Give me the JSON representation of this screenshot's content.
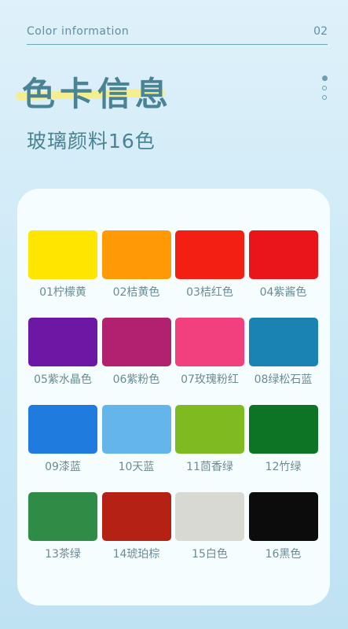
{
  "header": {
    "title": "Color information",
    "page_number": "02"
  },
  "title": "色卡信息",
  "subtitle": "玻璃颜料16色",
  "swatches": [
    {
      "label": "01柠檬黄",
      "color": "#ffe600"
    },
    {
      "label": "02桔黄色",
      "color": "#ff9a06"
    },
    {
      "label": "03桔红色",
      "color": "#f31f12"
    },
    {
      "label": "04紫酱色",
      "color": "#e9151a"
    },
    {
      "label": "05紫水晶色",
      "color": "#6c18a5"
    },
    {
      "label": "06紫粉色",
      "color": "#b2216f"
    },
    {
      "label": "07玫瑰粉红",
      "color": "#f23f7d"
    },
    {
      "label": "08绿松石蓝",
      "color": "#1a83b4"
    },
    {
      "label": "09漆蓝",
      "color": "#1f7bdd"
    },
    {
      "label": "10天蓝",
      "color": "#63b5ea"
    },
    {
      "label": "11茴香绿",
      "color": "#7fba21"
    },
    {
      "label": "12竹绿",
      "color": "#0d7425"
    },
    {
      "label": "13茶绿",
      "color": "#2e8c47"
    },
    {
      "label": "14琥珀棕",
      "color": "#b52112"
    },
    {
      "label": "15白色",
      "color": "#d9d9d4"
    },
    {
      "label": "16黑色",
      "color": "#0c0c0c"
    }
  ]
}
